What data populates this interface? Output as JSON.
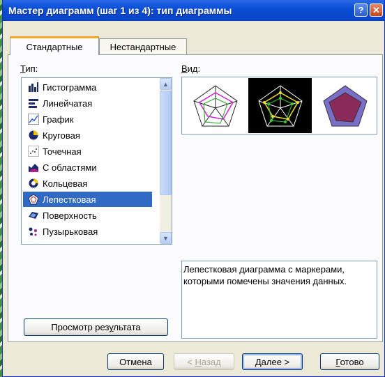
{
  "window": {
    "title": "Мастер диаграмм (шаг 1 из 4): тип диаграммы",
    "help_icon": "?",
    "close_icon": "✕"
  },
  "tabs": [
    {
      "label": "Стандартные",
      "active": true
    },
    {
      "label": "Нестандартные",
      "active": false
    }
  ],
  "type_label": "Тип:",
  "view_label": "Вид:",
  "chart_types": [
    {
      "label": "Гистограмма",
      "icon": "column-chart-icon"
    },
    {
      "label": "Линейчатая",
      "icon": "bar-chart-icon"
    },
    {
      "label": "График",
      "icon": "line-chart-icon"
    },
    {
      "label": "Круговая",
      "icon": "pie-chart-icon"
    },
    {
      "label": "Точечная",
      "icon": "scatter-chart-icon"
    },
    {
      "label": "С областями",
      "icon": "area-chart-icon"
    },
    {
      "label": "Кольцевая",
      "icon": "doughnut-chart-icon"
    },
    {
      "label": "Лепестковая",
      "icon": "radar-chart-icon",
      "selected": true
    },
    {
      "label": "Поверхность",
      "icon": "surface-chart-icon"
    },
    {
      "label": "Пузырьковая",
      "icon": "bubble-chart-icon"
    }
  ],
  "description": "Лепестковая диаграмма с маркерами, которыми помечены значения данных.",
  "buttons": {
    "preview": "Просмотр результата",
    "cancel": "Отмена",
    "back": "< Назад",
    "next": "Далее >",
    "finish": "Готово"
  },
  "colors": {
    "title_bar": "#0a4fd6",
    "selection": "#316ac5",
    "tab_accent": "#f5a623"
  }
}
